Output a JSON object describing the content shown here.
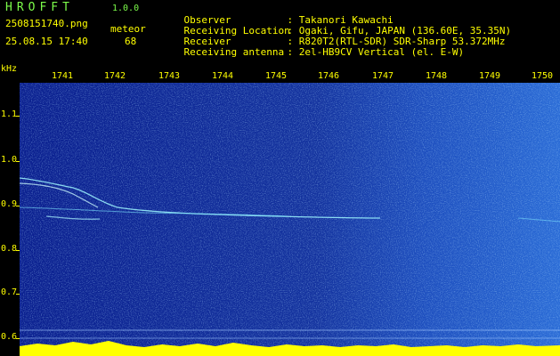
{
  "header": {
    "app_title": "HROFFT",
    "app_version": "1.0.0",
    "file_name": "2508151740.png",
    "timestamp": "25.08.15 17:40",
    "meteor_label": "meteor",
    "meteor_count": "68"
  },
  "info": [
    {
      "key": "Observer",
      "value": ": Takanori Kawachi"
    },
    {
      "key": "Receiving Location",
      "value": ": Ogaki, Gifu, JAPAN (136.60E, 35.35N)"
    },
    {
      "key": "Receiver",
      "value": ": R820T2(RTL-SDR) SDR-Sharp 53.372MHz"
    },
    {
      "key": "Receiving antenna",
      "value": ": 2el-HB9CV Vertical (el. E-W)"
    }
  ],
  "axes": {
    "y_unit": "kHz",
    "x_ticks": [
      "1741",
      "1742",
      "1743",
      "1744",
      "1745",
      "1746",
      "1747",
      "1748",
      "1749",
      "1750"
    ],
    "y_ticks": [
      "1.1",
      "1.0",
      "0.9",
      "0.8",
      "0.7",
      "0.6"
    ]
  },
  "colors": {
    "background": "#000000",
    "spectrum_dark": "#0a1f8f",
    "spectrum_bright": "#2a6bd6",
    "signal": "#9ff8ff",
    "baseline": "#FFFF00",
    "text_yellow": "#FFFF00",
    "title_green": "#7CFC4A"
  }
}
